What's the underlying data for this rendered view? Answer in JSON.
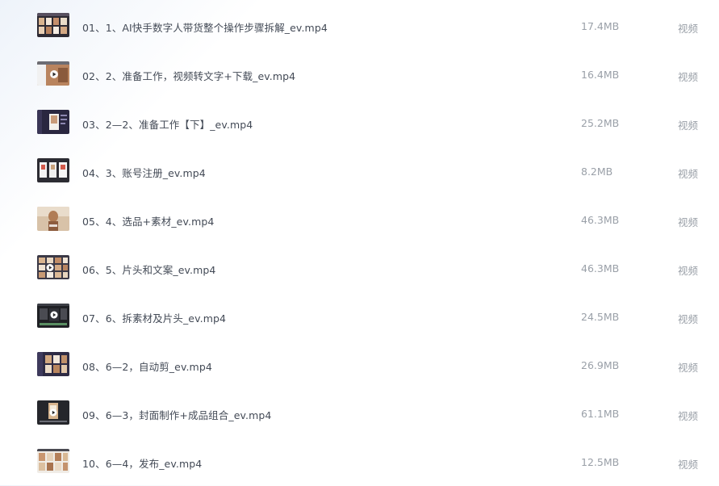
{
  "files": [
    {
      "name": "01、1、AI快手数字人带货整个操作步骤拆解_ev.mp4",
      "size": "17.4MB",
      "type": "视频",
      "thumb_icon": "video-thumbnail-icon"
    },
    {
      "name": "02、2、准备工作，视频转文字+下载_ev.mp4",
      "size": "16.4MB",
      "type": "视频",
      "thumb_icon": "video-thumbnail-icon"
    },
    {
      "name": "03、2—2、准备工作【下】_ev.mp4",
      "size": "25.2MB",
      "type": "视频",
      "thumb_icon": "video-thumbnail-icon"
    },
    {
      "name": "04、3、账号注册_ev.mp4",
      "size": "8.2MB",
      "type": "视频",
      "thumb_icon": "video-thumbnail-icon"
    },
    {
      "name": "05、4、选品+素材_ev.mp4",
      "size": "46.3MB",
      "type": "视频",
      "thumb_icon": "video-thumbnail-icon"
    },
    {
      "name": "06、5、片头和文案_ev.mp4",
      "size": "46.3MB",
      "type": "视频",
      "thumb_icon": "video-thumbnail-icon"
    },
    {
      "name": "07、6、拆素材及片头_ev.mp4",
      "size": "24.5MB",
      "type": "视频",
      "thumb_icon": "video-thumbnail-icon"
    },
    {
      "name": "08、6—2，自动剪_ev.mp4",
      "size": "26.9MB",
      "type": "视频",
      "thumb_icon": "video-thumbnail-icon"
    },
    {
      "name": "09、6—3，封面制作+成品组合_ev.mp4",
      "size": "61.1MB",
      "type": "视频",
      "thumb_icon": "video-thumbnail-icon"
    },
    {
      "name": "10、6—4，发布_ev.mp4",
      "size": "12.5MB",
      "type": "视频",
      "thumb_icon": "video-thumbnail-icon"
    }
  ],
  "colors": {
    "text_primary": "#434a56",
    "text_secondary": "#9aa0a8",
    "thumb_dark": "#2b2b3a",
    "thumb_warm": "#c9a27c"
  }
}
